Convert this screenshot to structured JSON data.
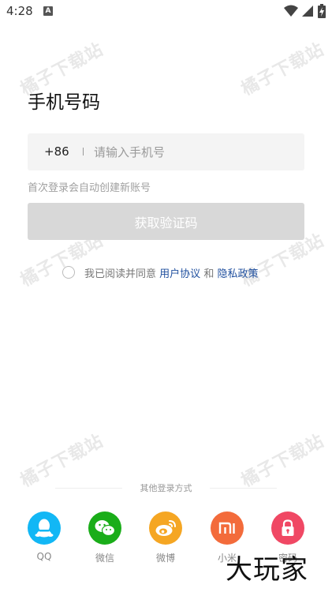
{
  "status_bar": {
    "time": "4:28",
    "notification_glyph": "A"
  },
  "watermark_text": "橘子下载站",
  "page_title": "手机号码",
  "phone": {
    "country_code": "+86",
    "placeholder": "请输入手机号",
    "value": ""
  },
  "hint": "首次登录会自动创建新账号",
  "get_code_label": "获取验证码",
  "agreement": {
    "prefix": "我已阅读并同意",
    "user_agreement": "用户协议",
    "and": "和",
    "privacy_policy": "隐私政策"
  },
  "other_login": {
    "label": "其他登录方式",
    "providers": [
      {
        "name": "QQ",
        "icon": "qq-icon",
        "color": "#12b7f5"
      },
      {
        "name": "微信",
        "icon": "wechat-icon",
        "color": "#1aad19"
      },
      {
        "name": "微博",
        "icon": "weibo-icon",
        "color": "#f5a623"
      },
      {
        "name": "小米",
        "icon": "xiaomi-icon",
        "color": "#f36b3b"
      },
      {
        "name": "密码",
        "icon": "lock-icon",
        "color": "#f04864"
      }
    ]
  },
  "corner_logo": "大玩家"
}
